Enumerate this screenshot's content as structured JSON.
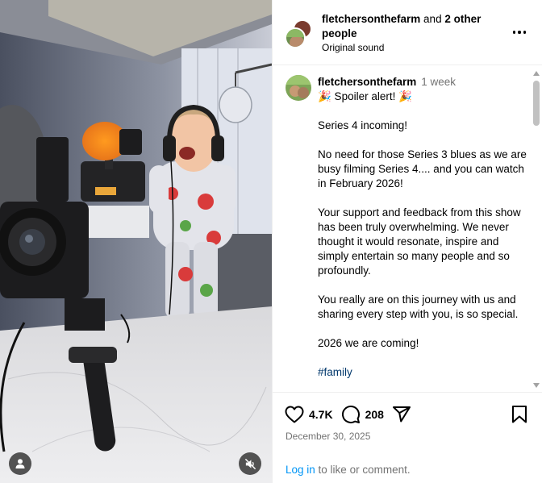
{
  "header": {
    "username": "fletchersonthefarm",
    "connector": "and",
    "others": "2 other people",
    "audio": "Original sound"
  },
  "caption": {
    "username": "fletchersonthefarm",
    "time": "1 week",
    "lines": [
      "🎉 Spoiler alert! 🎉",
      "Series 4 incoming!",
      "No need for those Series 3 blues as we are busy filming Series 4.... and you can watch in February 2026!",
      "Your support and feedback from this show has been truly overwhelming. We never thought it would resonate, inspire and simply entertain so many people and so profoundly.",
      "You really are on this journey with us and sharing every step with you, is so special.",
      "2026 we are coming!"
    ],
    "hashtag": "#family"
  },
  "actions": {
    "likes": "4.7K",
    "comments": "208"
  },
  "date": "December 30, 2025",
  "login": {
    "link": "Log in",
    "rest": " to like or comment."
  },
  "icons": {
    "like": "heart-icon",
    "comment": "comment-icon",
    "share": "share-icon",
    "save": "bookmark-icon",
    "more": "more-options-icon",
    "tag": "user-tag-icon",
    "mute": "muted-speaker-icon"
  },
  "colors": {
    "link": "#0095f6",
    "hashtag": "#00376b",
    "muted_text": "#737373"
  }
}
